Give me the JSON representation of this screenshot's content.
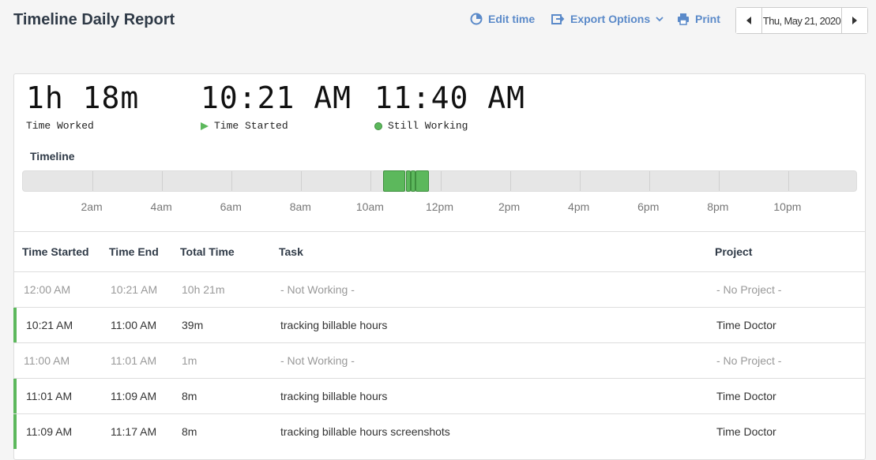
{
  "header": {
    "title": "Timeline Daily Report",
    "edit_time": "Edit time",
    "export_options": "Export Options",
    "print": "Print",
    "date": "Thu, May 21, 2020"
  },
  "summary": {
    "time_worked": {
      "value": "1h 18m",
      "label": "Time Worked"
    },
    "time_started": {
      "value": "10:21 AM",
      "label": "Time Started"
    },
    "still_working": {
      "value": "11:40 AM",
      "label": "Still Working"
    }
  },
  "timeline": {
    "label": "Timeline",
    "hours": [
      "2am",
      "4am",
      "6am",
      "8am",
      "10am",
      "12pm",
      "2pm",
      "4pm",
      "6pm",
      "8pm",
      "10pm"
    ],
    "segments": [
      {
        "start": "10:21 AM",
        "end": "11:00 AM"
      },
      {
        "start": "11:01 AM",
        "end": "11:09 AM"
      },
      {
        "start": "11:09 AM",
        "end": "11:17 AM"
      },
      {
        "start": "11:17 AM",
        "end": "11:40 AM"
      }
    ],
    "accent_color": "#5cb85c"
  },
  "table": {
    "columns": [
      "Time Started",
      "Time End",
      "Total Time",
      "Task",
      "Project"
    ],
    "rows": [
      {
        "start": "12:00 AM",
        "end": "10:21 AM",
        "total": "10h 21m",
        "task": "- Not Working -",
        "project": "- No Project -",
        "working": false
      },
      {
        "start": "10:21 AM",
        "end": "11:00 AM",
        "total": "39m",
        "task": "tracking billable hours",
        "project": "Time Doctor",
        "working": true
      },
      {
        "start": "11:00 AM",
        "end": "11:01 AM",
        "total": "1m",
        "task": "- Not Working -",
        "project": "- No Project -",
        "working": false
      },
      {
        "start": "11:01 AM",
        "end": "11:09 AM",
        "total": "8m",
        "task": "tracking billable hours",
        "project": "Time Doctor",
        "working": true
      },
      {
        "start": "11:09 AM",
        "end": "11:17 AM",
        "total": "8m",
        "task": "tracking billable hours screenshots",
        "project": "Time Doctor",
        "working": true
      }
    ]
  }
}
